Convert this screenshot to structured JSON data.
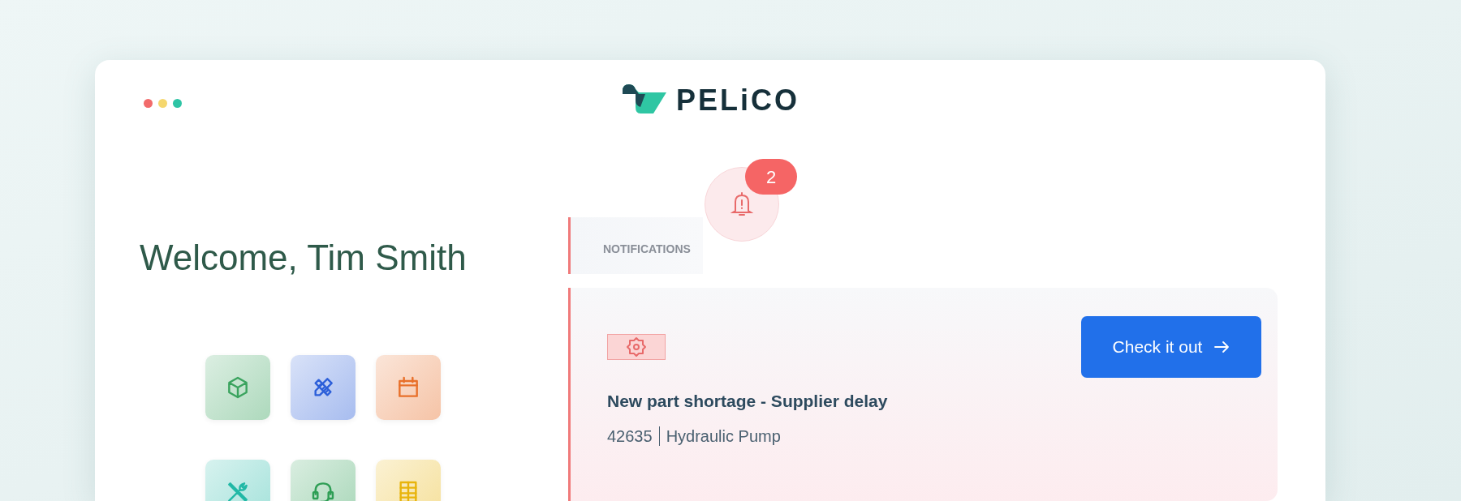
{
  "window": {
    "dots": [
      {
        "color": "#f26b6b"
      },
      {
        "color": "#f5d76e"
      },
      {
        "color": "#2ec4a5"
      }
    ]
  },
  "logo": {
    "text": "PELiCO"
  },
  "welcome": "Welcome, Tim Smith",
  "apps": [
    {
      "kind": "cube",
      "color": "#3aa35e"
    },
    {
      "kind": "ruler",
      "color": "#2c5fd9"
    },
    {
      "kind": "calendar",
      "color": "#e8702a"
    },
    {
      "kind": "tools",
      "color": "#21b8a6"
    },
    {
      "kind": "headset",
      "color": "#2e9e55"
    },
    {
      "kind": "table",
      "color": "#e8b40c"
    }
  ],
  "notifications": {
    "tab": "NOTIFICATIONS",
    "count": "2",
    "items": [
      {
        "title": "New part shortage - Supplier delay",
        "number": "42635",
        "part": "Hydraulic Pump",
        "action": "Check it out"
      }
    ]
  }
}
